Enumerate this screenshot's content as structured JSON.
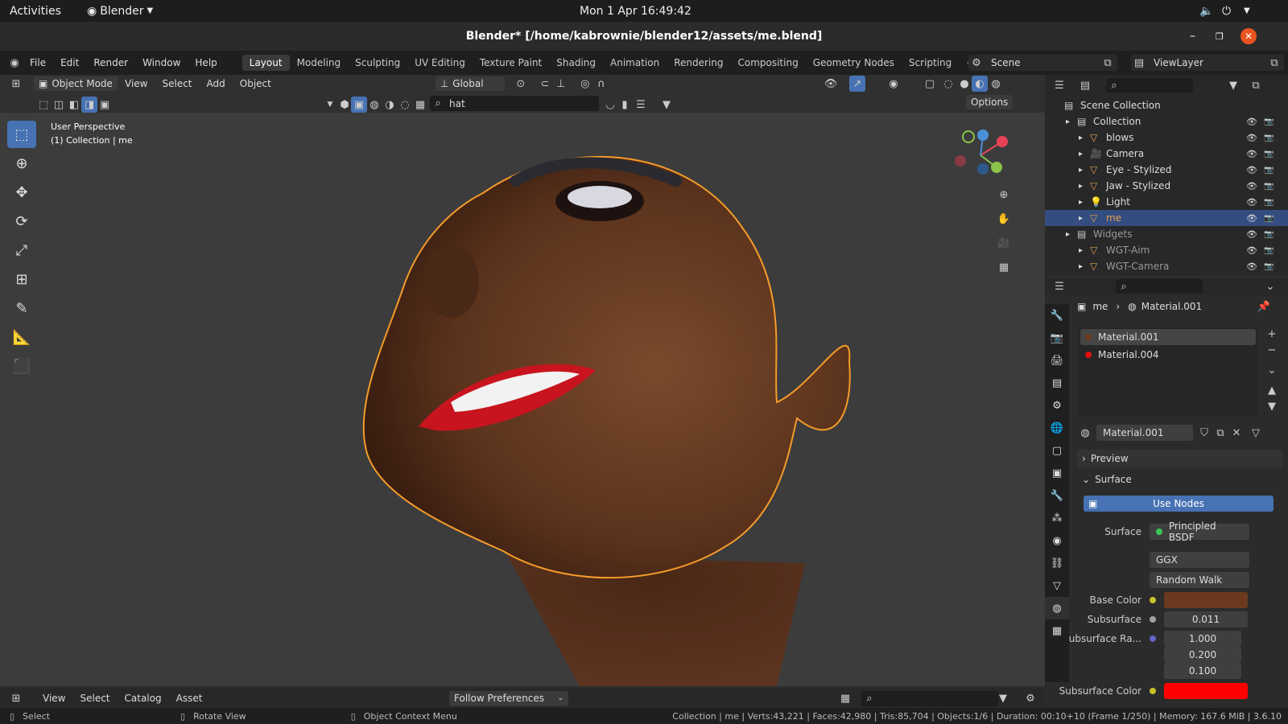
{
  "gnome": {
    "activities": "Activities",
    "app": "Blender",
    "clock": "Mon 1 Apr  16:49:42"
  },
  "title": "Blender* [/home/kabrownie/blender12/assets/me.blend]",
  "menus": [
    "File",
    "Edit",
    "Render",
    "Window",
    "Help"
  ],
  "workspaces": [
    "Layout",
    "Modeling",
    "Sculpting",
    "UV Editing",
    "Texture Paint",
    "Shading",
    "Animation",
    "Rendering",
    "Compositing",
    "Geometry Nodes",
    "Scripting"
  ],
  "scene": "Scene",
  "viewlayer": "ViewLayer",
  "header": {
    "mode": "Object Mode",
    "view": "View",
    "select": "Select",
    "add": "Add",
    "object": "Object",
    "orientation": "Global",
    "search": "hat",
    "options": "Options"
  },
  "viewport": {
    "persp": "User Perspective",
    "collection": "(1) Collection | me"
  },
  "outliner": {
    "search": "",
    "rows": [
      {
        "label": "Scene Collection",
        "indent": 0
      },
      {
        "label": "Collection",
        "indent": 1
      },
      {
        "label": "blows",
        "indent": 2
      },
      {
        "label": "Camera",
        "indent": 2
      },
      {
        "label": "Eye - Stylized",
        "indent": 2
      },
      {
        "label": "Jaw - Stylized",
        "indent": 2
      },
      {
        "label": "Light",
        "indent": 2
      },
      {
        "label": "me",
        "indent": 2
      },
      {
        "label": "Widgets",
        "indent": 1
      },
      {
        "label": "WGT-Aim",
        "indent": 2
      },
      {
        "label": "WGT-Camera",
        "indent": 2
      }
    ]
  },
  "props": {
    "breadcrumb_obj": "me",
    "breadcrumb_mat": "Material.001",
    "slots": [
      "Material.001",
      "Material.004"
    ],
    "material": "Material.001",
    "preview": "Preview",
    "surface_panel": "Surface",
    "use_nodes": "Use Nodes",
    "surface_label": "Surface",
    "surface_val": "Principled BSDF",
    "dist": "GGX",
    "sss_method": "Random Walk",
    "base_color_label": "Base Color",
    "subsurface_label": "Subsurface",
    "subsurface_val": "0.011",
    "radius_label": "Subsurface Ra...",
    "radius": [
      "1.000",
      "0.200",
      "0.100"
    ],
    "sss_color_label": "Subsurface Color",
    "base_color": "#6b3a1e",
    "sss_color": "#ff0000"
  },
  "footer": {
    "view": "View",
    "select": "Select",
    "catalog": "Catalog",
    "asset": "Asset",
    "follow": "Follow Preferences"
  },
  "status": {
    "select": "Select",
    "rotate": "Rotate View",
    "context": "Object Context Menu",
    "stats": "Collection | me | Verts:43,221 | Faces:42,980 | Tris:85,704 | Objects:1/6 | Duration: 00:10+10 (Frame 1/250) | Memory: 167.6 MiB | 3.6.10"
  }
}
